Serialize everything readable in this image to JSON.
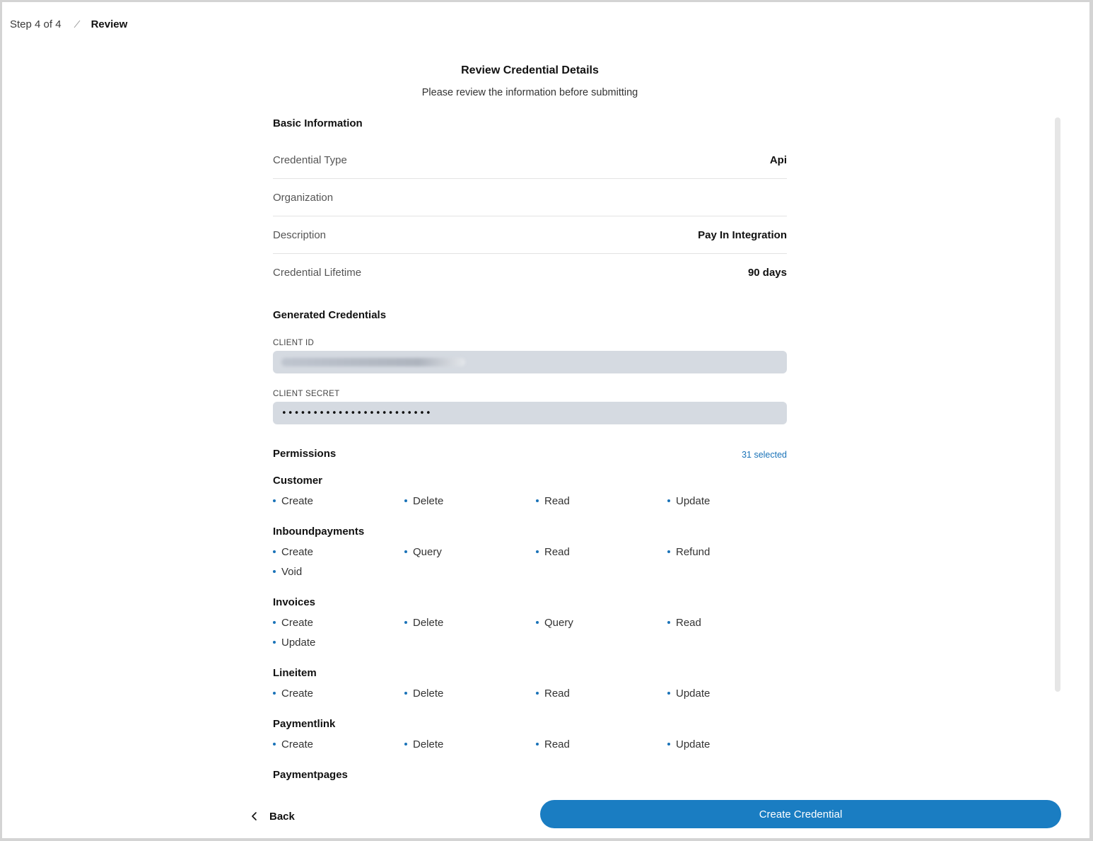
{
  "breadcrumb": {
    "step": "Step 4 of 4",
    "current": "Review"
  },
  "header": {
    "title": "Review Credential Details",
    "subtitle": "Please review the information before submitting"
  },
  "basic_info": {
    "title": "Basic Information",
    "rows": [
      {
        "label": "Credential Type",
        "value": "Api"
      },
      {
        "label": "Organization",
        "value": ""
      },
      {
        "label": "Description",
        "value": "Pay In Integration"
      },
      {
        "label": "Credential Lifetime",
        "value": "90 days"
      }
    ]
  },
  "generated": {
    "title": "Generated Credentials",
    "client_id_label": "CLIENT ID",
    "client_secret_label": "CLIENT SECRET",
    "client_secret_value": "••••••••••••••••••••••••"
  },
  "permissions": {
    "title": "Permissions",
    "count": "31 selected",
    "groups": [
      {
        "name": "Customer",
        "items": [
          "Create",
          "Delete",
          "Read",
          "Update"
        ]
      },
      {
        "name": "Inboundpayments",
        "items": [
          "Create",
          "Query",
          "Read",
          "Refund",
          "Void"
        ]
      },
      {
        "name": "Invoices",
        "items": [
          "Create",
          "Delete",
          "Query",
          "Read",
          "Update"
        ]
      },
      {
        "name": "Lineitem",
        "items": [
          "Create",
          "Delete",
          "Read",
          "Update"
        ]
      },
      {
        "name": "Paymentlink",
        "items": [
          "Create",
          "Delete",
          "Read",
          "Update"
        ]
      },
      {
        "name": "Paymentpages",
        "items": []
      }
    ]
  },
  "footer": {
    "back_label": "Back",
    "create_label": "Create Credential"
  },
  "colors": {
    "accent": "#1a7dc2",
    "field_bg": "#d5dae1"
  },
  "icons": {
    "separator": "slash-separator-icon",
    "back": "chevron-left-icon"
  }
}
